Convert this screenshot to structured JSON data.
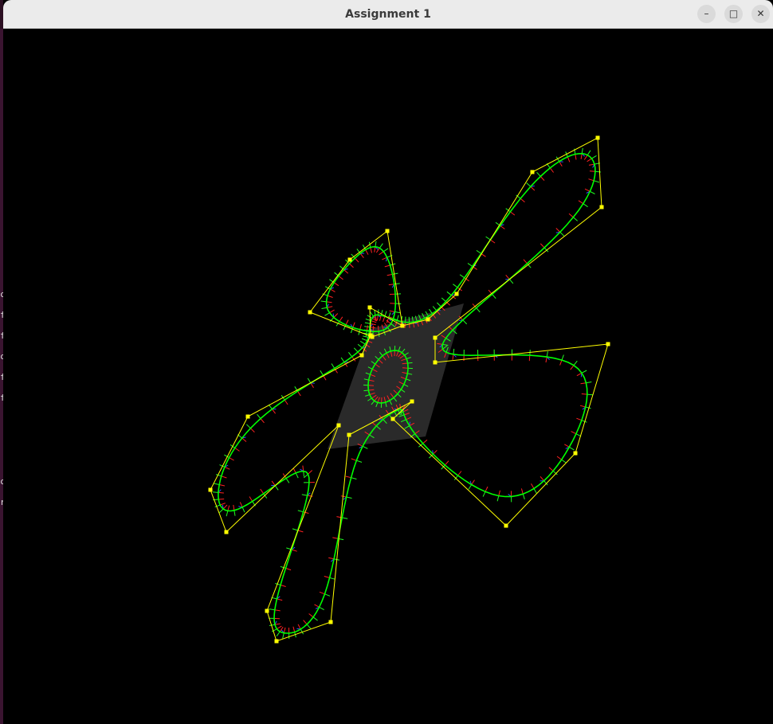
{
  "window": {
    "title": "Assignment 1",
    "controls": {
      "minimize": "–",
      "maximize": "□",
      "close": "✕"
    }
  },
  "colors": {
    "background": "#000000",
    "control_polygon": "#ffff00",
    "curve": "#00ff00",
    "normals_red": "#ff2020",
    "normals_green": "#20ff20",
    "normals_blue": "#3050ff",
    "plane": "#2a2a2a"
  },
  "left_peek_glyphs": [
    "c",
    "f",
    "f",
    "c",
    "f",
    "f",
    "c",
    "r"
  ]
}
